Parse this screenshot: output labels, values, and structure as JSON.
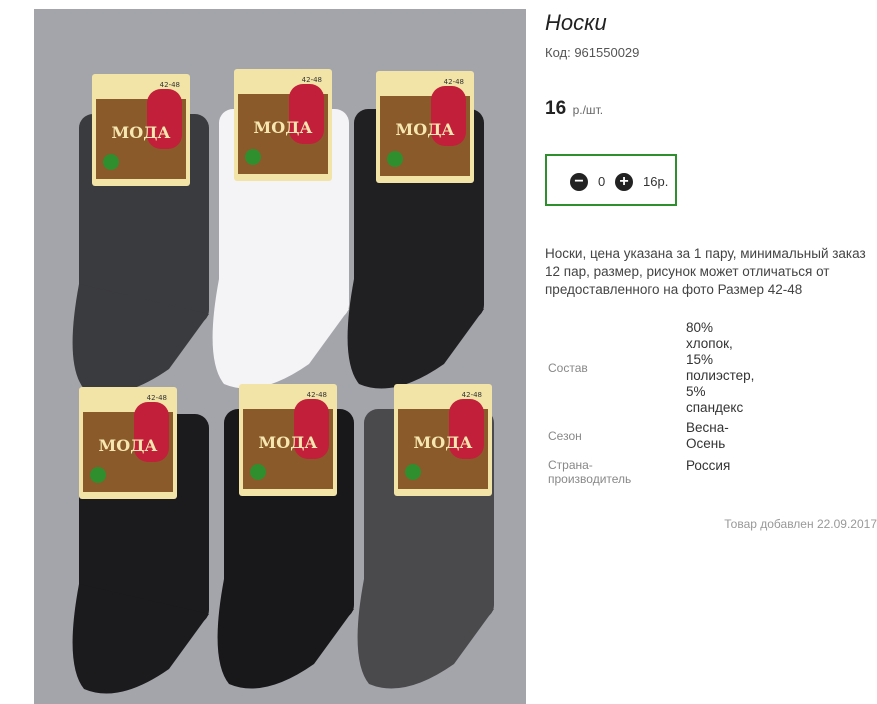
{
  "product": {
    "title": "Носки",
    "code": "Код: 961550029",
    "price_value": "16",
    "price_unit": "р./шт.",
    "description": "Носки, цена указана за 1 пару, минимальный заказ 12 пар, размер, рисунок может отличаться от предоставленного на фото Размер 42-48",
    "added": "Товар добавлен 22.09.2017"
  },
  "cart": {
    "minus": "−",
    "quantity": "0",
    "plus": "+",
    "sum": "16р."
  },
  "properties": [
    {
      "label": "Состав",
      "value": "80% хлопок, 15% полиэстер, 5% спандекс",
      "lines": [
        "80%",
        "хлопок,",
        "15%",
        "полиэстер,",
        "5%",
        "спандекс"
      ]
    },
    {
      "label": "Сезон",
      "value": "Весна-Осень",
      "lines": [
        "Весна-",
        "Осень"
      ]
    },
    {
      "label": "Страна-производитель",
      "lines_label": [
        "Страна-",
        "производитель"
      ],
      "value": "Россия"
    }
  ],
  "photo": {
    "label_text": "МОДА",
    "size_text": "42-48",
    "sock_colors": [
      "#3a3b3e",
      "#f4f4f6",
      "#202022",
      "#1b1b1d",
      "#18181a",
      "#4a4a4c"
    ],
    "accent_color": "#2f8f2f"
  }
}
